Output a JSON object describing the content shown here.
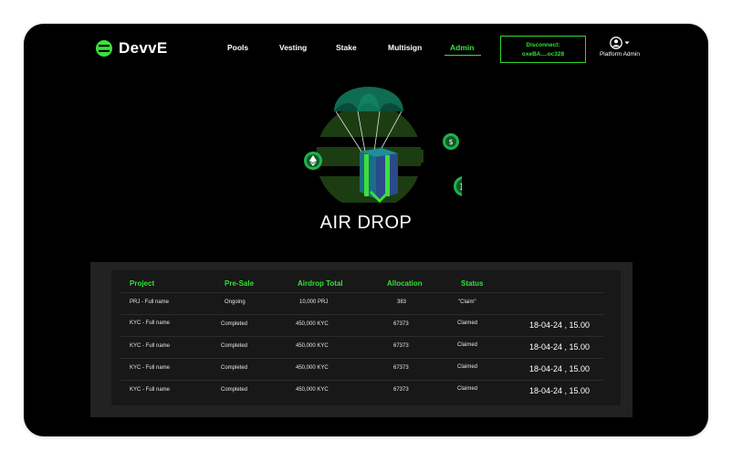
{
  "brand": {
    "name": "DevvE",
    "accent": "#3be03b"
  },
  "nav": {
    "items": [
      {
        "label": "Pools"
      },
      {
        "label": "Vesting"
      },
      {
        "label": "Stake"
      },
      {
        "label": "Multisign"
      },
      {
        "label": "Admin",
        "active": true
      }
    ]
  },
  "wallet": {
    "line1": "Disconnect:",
    "line2": "oxeBA....oc328"
  },
  "profile": {
    "label": "Platform Admin",
    "icon": "user-circle-icon"
  },
  "hero": {
    "title": "AIR DROP",
    "coins": [
      "ethereum-coin-icon",
      "tether-coin-icon",
      "bitcoin-coin-icon"
    ]
  },
  "table": {
    "headers": [
      "Project",
      "Pre-Sale",
      "Airdrop Total",
      "Allocation",
      "Status"
    ],
    "rows": [
      {
        "project": "PRJ - Full name",
        "presale": "Ongoing",
        "total": "10,000 PRJ",
        "allocation": "383",
        "status": "\"Claim\"",
        "time": ""
      },
      {
        "project": "KYC - Full name",
        "presale": "Completed",
        "total": "450,000 KYC",
        "allocation": "67373",
        "status": "Claimed",
        "time": "18-04-24 , 15.00"
      },
      {
        "project": "KYC - Full name",
        "presale": "Completed",
        "total": "450,000 KYC",
        "allocation": "67373",
        "status": "Claimed",
        "time": "18-04-24 , 15.00"
      },
      {
        "project": "KYC - Full name",
        "presale": "Completed",
        "total": "450,000 KYC",
        "allocation": "67373",
        "status": "Claimed",
        "time": "18-04-24 , 15.00"
      },
      {
        "project": "KYC - Full name",
        "presale": "Completed",
        "total": "450,000 KYC",
        "allocation": "67373",
        "status": "Claimed",
        "time": "18-04-24 , 15.00"
      }
    ]
  }
}
